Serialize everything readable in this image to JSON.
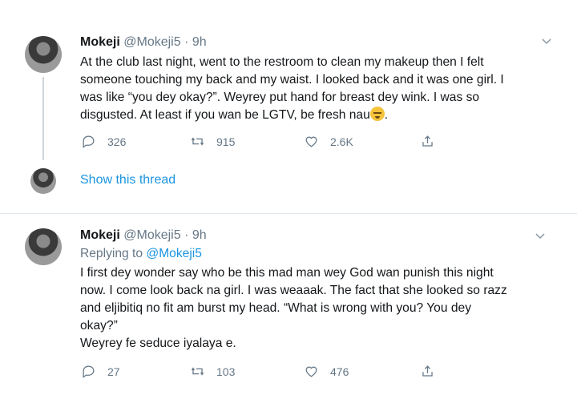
{
  "tweet1": {
    "name": "Mokeji",
    "handle": "@Mokeji5",
    "time": "· 9h",
    "text": [
      "At the club last night, went to the restroom to clean my makeup then I felt",
      "someone touching my back and my waist. I looked back and it was one girl. I",
      "was like “you dey okay?”. Weyrey put hand for breast dey wink. I was so",
      "disgusted. At least if you wan be LGTV, be fresh nau"
    ],
    "text_end": ".",
    "replies": "326",
    "retweets": "915",
    "likes": "2.6K"
  },
  "show_thread": "Show this thread",
  "tweet2": {
    "name": "Mokeji",
    "handle": "@Mokeji5",
    "time": "· 9h",
    "replying_prefix": "Replying to",
    "replying_to": "@Mokeji5",
    "text": [
      "I first dey wonder say who be this mad man wey God wan punish this night",
      "now. I come look back na girl. I was weaaak. The fact that she looked so razz",
      "and eljibitiq no fit am burst my head. “What is wrong with you? You dey",
      "okay?”",
      "Weyrey fe seduce iyalaya e."
    ],
    "replies": "27",
    "retweets": "103",
    "likes": "476"
  },
  "colors": {
    "accent": "#1b95e0",
    "secondary_text": "#657786",
    "divider": "#e1e8ed"
  },
  "icons": [
    "chevron-down-icon",
    "reply-icon",
    "retweet-icon",
    "like-icon",
    "share-icon"
  ]
}
